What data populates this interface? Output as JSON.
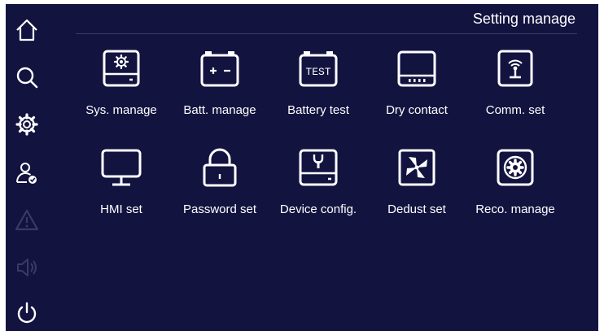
{
  "header": {
    "title": "Setting manage"
  },
  "sidebar": {
    "items": [
      {
        "name": "home-icon"
      },
      {
        "name": "search-icon"
      },
      {
        "name": "gear-icon"
      },
      {
        "name": "user-check-icon"
      },
      {
        "name": "warning-icon"
      },
      {
        "name": "speaker-icon"
      },
      {
        "name": "power-icon"
      }
    ]
  },
  "tiles": [
    {
      "label": "Sys. manage",
      "icon": "system-manage-icon"
    },
    {
      "label": "Batt. manage",
      "icon": "battery-icon"
    },
    {
      "label": "Battery test",
      "icon": "battery-test-icon",
      "icon_text": "TEST"
    },
    {
      "label": "Dry contact",
      "icon": "dry-contact-icon"
    },
    {
      "label": "Comm. set",
      "icon": "antenna-icon"
    },
    {
      "label": "HMI set",
      "icon": "monitor-icon"
    },
    {
      "label": "Password set",
      "icon": "lock-icon"
    },
    {
      "label": "Device config.",
      "icon": "wrench-box-icon"
    },
    {
      "label": "Dedust set",
      "icon": "fan-icon"
    },
    {
      "label": "Reco. manage",
      "icon": "gear-box-icon"
    }
  ],
  "colors": {
    "background": "#131340",
    "foreground": "#ffffff",
    "disabled": "#3a3a66"
  }
}
